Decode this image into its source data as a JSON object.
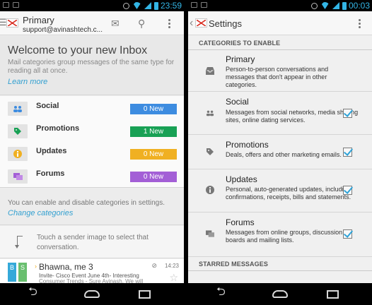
{
  "left": {
    "status_time": "23:59",
    "actionbar": {
      "title": "Primary",
      "account": "support@avinashtech.c..."
    },
    "welcome": {
      "title": "Welcome to your new Inbox",
      "body": "Mail categories group messages of the same type for reading all at once.",
      "link": "Learn more"
    },
    "categories": [
      {
        "label": "Social",
        "badge": "0 New",
        "color": "#3d8ce0",
        "icon": "people-icon"
      },
      {
        "label": "Promotions",
        "badge": "1 New",
        "color": "#18a155",
        "icon": "tag-icon"
      },
      {
        "label": "Updates",
        "badge": "0 New",
        "color": "#f0b022",
        "icon": "info-icon"
      },
      {
        "label": "Forums",
        "badge": "0 New",
        "color": "#a35fd6",
        "icon": "chat-bubbles-icon"
      }
    ],
    "enable_text": "You can enable and disable categories in settings.",
    "enable_link": "Change categories",
    "touch_text": "Touch a sender image to select that conversation.",
    "mail": {
      "avatar1": "B",
      "avatar2": "S",
      "sender": "Bhawna, me 3",
      "time": "14:23",
      "subject": "Invite- Cisco Event June 4th- Interesting",
      "snippet": "Consumer Trends - Sure Avinash, We will"
    }
  },
  "right": {
    "status_time": "00:03",
    "title": "Settings",
    "section_categories": "CATEGORIES TO ENABLE",
    "items": [
      {
        "name": "Primary",
        "desc": "Person-to-person conversations and messages that don't appear in other categories.",
        "checked": false
      },
      {
        "name": "Social",
        "desc": "Messages from social networks, media sharing sites, online dating services.",
        "checked": true
      },
      {
        "name": "Promotions",
        "desc": "Deals, offers and other marketing emails.",
        "checked": true
      },
      {
        "name": "Updates",
        "desc": "Personal, auto-generated updates, including confirmations, receipts, bills and statements.",
        "checked": true
      },
      {
        "name": "Forums",
        "desc": "Messages from online groups, discussion boards and mailing lists.",
        "checked": true
      }
    ],
    "section_starred": "STARRED MESSAGES"
  },
  "colors": {
    "link": "#33a0d0",
    "status_blue": "#33b5e5",
    "check": "#2fa3d8"
  }
}
